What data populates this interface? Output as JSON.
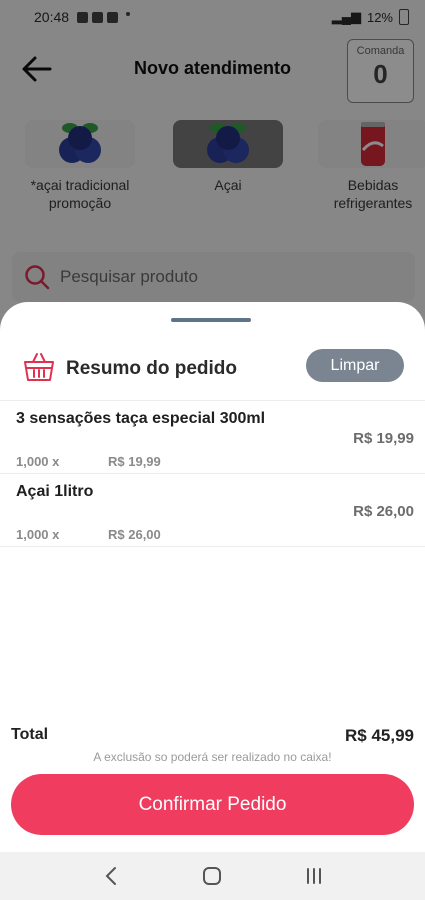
{
  "status_bar": {
    "time": "20:48",
    "battery": "12%"
  },
  "header": {
    "title": "Novo atendimento",
    "comanda_label": "Comanda",
    "comanda_value": "0"
  },
  "categories": [
    {
      "label_line1": "*açai tradicional",
      "label_line2": "promoção",
      "icon": "acai-berries-icon",
      "selected": false
    },
    {
      "label_line1": "Açai",
      "label_line2": "",
      "icon": "acai-berries-icon",
      "selected": true
    },
    {
      "label_line1": "Bebidas",
      "label_line2": "refrigerantes",
      "icon": "soda-can-icon",
      "selected": false
    }
  ],
  "search": {
    "placeholder": "Pesquisar produto"
  },
  "order_summary": {
    "title": "Resumo do pedido",
    "clear_label": "Limpar",
    "items": [
      {
        "name": "3 sensações taça especial 300ml",
        "quantity": "1,000 x",
        "unit_price": "R$ 19,99",
        "total": "R$ 19,99"
      },
      {
        "name": "Açai 1litro",
        "quantity": "1,000 x",
        "unit_price": "R$ 26,00",
        "total": "R$ 26,00"
      }
    ],
    "total_label": "Total",
    "total_value": "R$ 45,99",
    "notice": "A exclusão so poderá ser realizado no caixa!",
    "confirm_label": "Confirmar Pedido"
  },
  "colors": {
    "accent": "#f03d5f",
    "clear_button": "#7a8591",
    "handle": "#5e7288"
  }
}
